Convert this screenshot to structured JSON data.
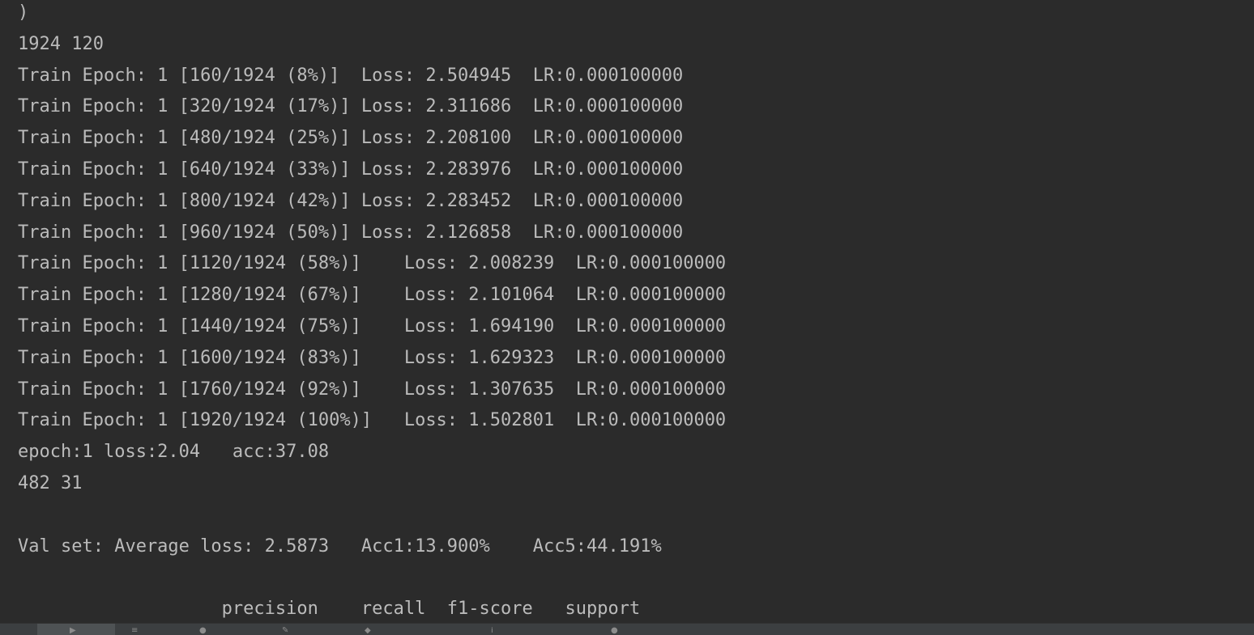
{
  "console": {
    "lines": [
      ")",
      "1924 120",
      "Train Epoch: 1 [160/1924 (8%)]  Loss: 2.504945  LR:0.000100000",
      "Train Epoch: 1 [320/1924 (17%)] Loss: 2.311686  LR:0.000100000",
      "Train Epoch: 1 [480/1924 (25%)] Loss: 2.208100  LR:0.000100000",
      "Train Epoch: 1 [640/1924 (33%)] Loss: 2.283976  LR:0.000100000",
      "Train Epoch: 1 [800/1924 (42%)] Loss: 2.283452  LR:0.000100000",
      "Train Epoch: 1 [960/1924 (50%)] Loss: 2.126858  LR:0.000100000",
      "Train Epoch: 1 [1120/1924 (58%)]    Loss: 2.008239  LR:0.000100000",
      "Train Epoch: 1 [1280/1924 (67%)]    Loss: 2.101064  LR:0.000100000",
      "Train Epoch: 1 [1440/1924 (75%)]    Loss: 1.694190  LR:0.000100000",
      "Train Epoch: 1 [1600/1924 (83%)]    Loss: 1.629323  LR:0.000100000",
      "Train Epoch: 1 [1760/1924 (92%)]    Loss: 1.307635  LR:0.000100000",
      "Train Epoch: 1 [1920/1924 (100%)]   Loss: 1.502801  LR:0.000100000",
      "epoch:1 loss:2.04   acc:37.08",
      "482 31",
      "",
      "Val set: Average loss: 2.5873   Acc1:13.900%    Acc5:44.191%",
      "",
      "                   precision    recall  f1-score   support"
    ]
  },
  "colors": {
    "background": "#2b2b2b",
    "text": "#bbbbbb",
    "toolbar": "#3c3f41"
  },
  "toolbar": {
    "icons": [
      "run-icon",
      "list-icon",
      "user-icon",
      "edit-icon",
      "layers-icon",
      "info-icon",
      "user-icon"
    ]
  }
}
